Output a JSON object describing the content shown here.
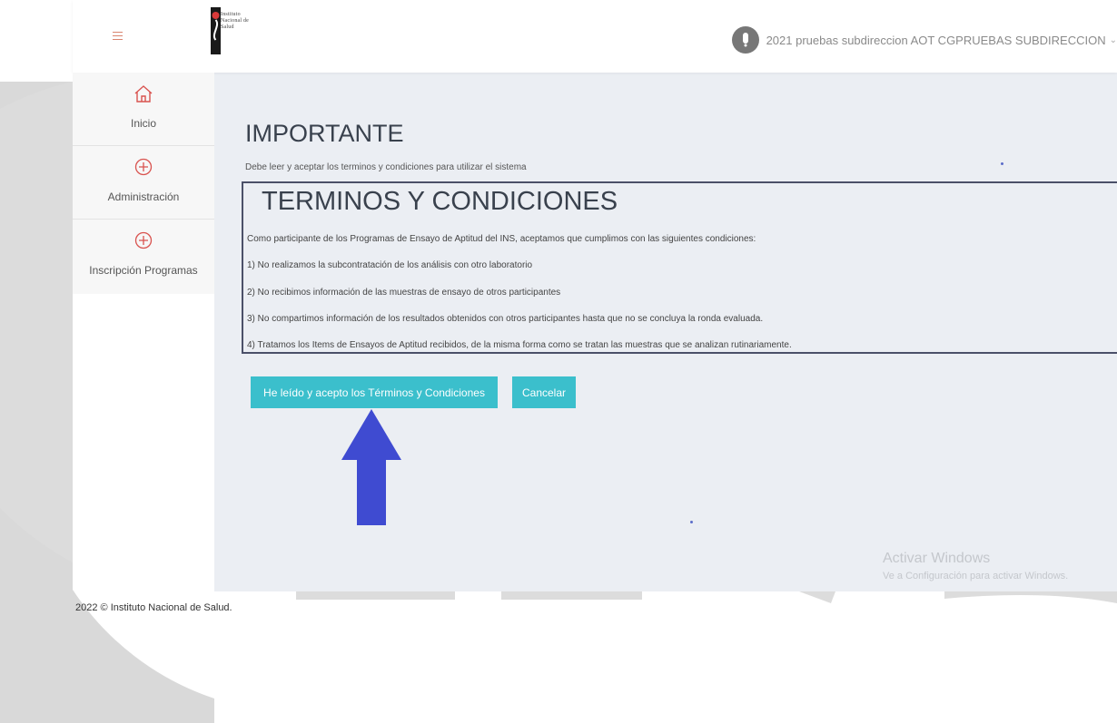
{
  "header": {
    "logo_lines": [
      "Instituto",
      "Nacional de",
      "Salud"
    ],
    "user_name": "2021 pruebas subdireccion AOT CGPRUEBAS SUBDIRECCION",
    "user_icon": "avatar-icon",
    "menu_icon": "hamburger-icon"
  },
  "sidebar": {
    "items": [
      {
        "label": "Inicio",
        "icon": "home-icon"
      },
      {
        "label": "Administración",
        "icon": "plus-circle-icon"
      },
      {
        "label": "Inscripción Programas",
        "icon": "plus-circle-icon"
      }
    ]
  },
  "main": {
    "title": "IMPORTANTE",
    "subtitle": "Debe leer y aceptar los terminos y condiciones para utilizar el sistema",
    "terms": {
      "title": "TERMINOS Y CONDICIONES",
      "intro": "Como participante de los Programas de Ensayo de Aptitud del INS, aceptamos que cumplimos con las siguientes condiciones:",
      "items": [
        "1) No realizamos la subcontratación de los análisis con otro laboratorio",
        "2) No recibimos información de las muestras de ensayo de otros participantes",
        "3) No compartimos información de los resultados obtenidos con otros participantes hasta que no se concluya la ronda evaluada.",
        "4) Tratamos los Items de Ensayos de Aptitud recibidos, de la misma forma como se tratan las muestras que se analizan rutinariamente."
      ]
    },
    "accept_label": "He leído y acepto los Términos y Condiciones",
    "cancel_label": "Cancelar"
  },
  "windows_watermark": {
    "title": "Activar Windows",
    "subtitle": "Ve a Configuración para activar Windows."
  },
  "footer": {
    "text": "2022 © Instituto Nacional de Salud."
  },
  "colors": {
    "button": "#3bbfcc",
    "arrow": "#3f4bd1",
    "accent_icon": "#d9534f",
    "main_bg": "#ebeef3"
  }
}
